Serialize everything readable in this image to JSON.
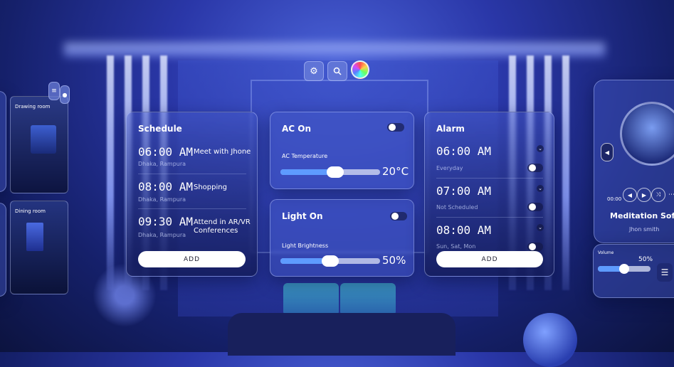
{
  "toolbar": {
    "settings_icon": "gear-icon",
    "search_icon": "search-icon",
    "color_icon": "color-wheel-icon"
  },
  "schedule": {
    "title": "Schedule",
    "items": [
      {
        "time": "06:00 AM",
        "location": "Dhaka, Rampura",
        "event": "Meet with Jhone"
      },
      {
        "time": "08:00 AM",
        "location": "Dhaka, Rampura",
        "event": "Shopping"
      },
      {
        "time": "09:30 AM",
        "location": "Dhaka, Rampura",
        "event": "Attend in AR/VR Conferences"
      }
    ],
    "add_label": "ADD"
  },
  "ac": {
    "title": "AC On",
    "slider_label": "AC Temperature",
    "value": "20°C",
    "level": 0.55
  },
  "light": {
    "title": "Light On",
    "slider_label": "Light Brightness",
    "value": "50%",
    "level": 0.5
  },
  "alarm": {
    "title": "Alarm",
    "items": [
      {
        "time": "06:00 AM",
        "repeat": "Everyday"
      },
      {
        "time": "07:00 AM",
        "repeat": "Not Scheduled"
      },
      {
        "time": "08:00 AM",
        "repeat": "Sun, Sat, Mon"
      }
    ],
    "add_label": "ADD"
  },
  "left_panel": {
    "label1": "Drawing room",
    "label2": "Dining room"
  },
  "music": {
    "title": "Meditation Soft Music",
    "artist": "Jhon smith",
    "elapsed": "00:00",
    "volume_label": "Volume",
    "volume": "50%",
    "volume_level": 0.5
  }
}
